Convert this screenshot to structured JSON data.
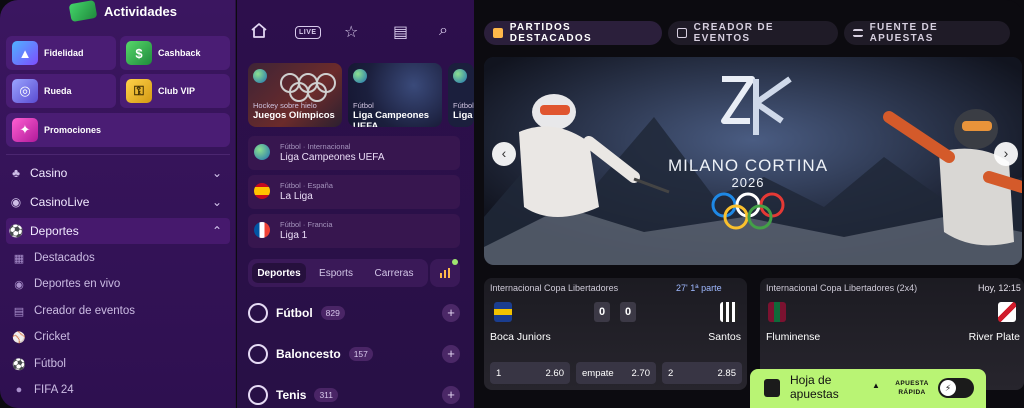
{
  "sidebar": {
    "activities_title": "Actividades",
    "tiles": [
      {
        "label": "Fidelidad"
      },
      {
        "label": "Cashback"
      },
      {
        "label": "Rueda"
      },
      {
        "label": "Club VIP"
      },
      {
        "label": "Promociones"
      }
    ],
    "sections": [
      {
        "label": "Casino",
        "icon": "casino-chip-icon"
      },
      {
        "label": "CasinoLive",
        "icon": "live-broadcast-icon"
      },
      {
        "label": "Deportes",
        "icon": "soccer-ball-icon"
      }
    ],
    "sport_items": [
      {
        "label": "Destacados",
        "icon": "star-calendar-icon"
      },
      {
        "label": "Deportes en vivo",
        "icon": "live-broadcast-icon"
      },
      {
        "label": "Creador de eventos",
        "icon": "builder-icon"
      },
      {
        "label": "Cricket",
        "icon": "cricket-icon"
      },
      {
        "label": "Fútbol",
        "icon": "soccer-ball-icon"
      },
      {
        "label": "FIFA 24",
        "icon": "fifa-icon"
      }
    ]
  },
  "middle": {
    "nav_icons": [
      "home-icon",
      "live-icon",
      "star-icon",
      "betslip-icon",
      "search-icon"
    ],
    "live_badge": "LIVE",
    "featured": [
      {
        "sport": "Hockey sobre hielo",
        "name": "Juegos Olímpicos"
      },
      {
        "sport": "Fútbol",
        "name": "Liga Campeones UEFA"
      },
      {
        "sport": "Fútbol",
        "name": "Liga"
      }
    ],
    "leagues": [
      {
        "meta": "Fútbol · Internacional",
        "name": "Liga Campeones UEFA"
      },
      {
        "meta": "Fútbol · España",
        "name": "La Liga"
      },
      {
        "meta": "Fútbol · Francia",
        "name": "Liga 1"
      }
    ],
    "tabs": [
      "Deportes",
      "Esports",
      "Carreras"
    ],
    "sports": [
      {
        "name": "Fútbol",
        "count": "829"
      },
      {
        "name": "Baloncesto",
        "count": "157"
      },
      {
        "name": "Tenis",
        "count": "311"
      }
    ]
  },
  "right": {
    "tabs": [
      "PARTIDOS DESTACADOS",
      "CREADOR DE EVENTOS",
      "FUENTE DE APUESTAS"
    ],
    "banner": {
      "title": "MILANO CORTINA",
      "year": "2026"
    },
    "matches": [
      {
        "competition": "Internacional Copa Libertadores",
        "time": "27' 1ª parte",
        "home": "Boca Juniors",
        "away": "Santos",
        "score_home": "0",
        "score_away": "0",
        "odds": [
          {
            "label": "1",
            "value": "2.60"
          },
          {
            "label": "empate",
            "value": "2.70"
          },
          {
            "label": "2",
            "value": "2.85"
          }
        ]
      },
      {
        "competition": "Internacional Copa Libertadores (2x4)",
        "time": "Hoy, 12:15",
        "home": "Fluminense",
        "away": "River Plate"
      }
    ]
  },
  "betslip": {
    "title": "Hoja de apuestas",
    "quick_label": "APUESTA RÁPIDA"
  },
  "colors": {
    "sidebar_bg": "#3b1660",
    "accent_green": "#b9f474",
    "right_bg": "#0c0b10"
  }
}
